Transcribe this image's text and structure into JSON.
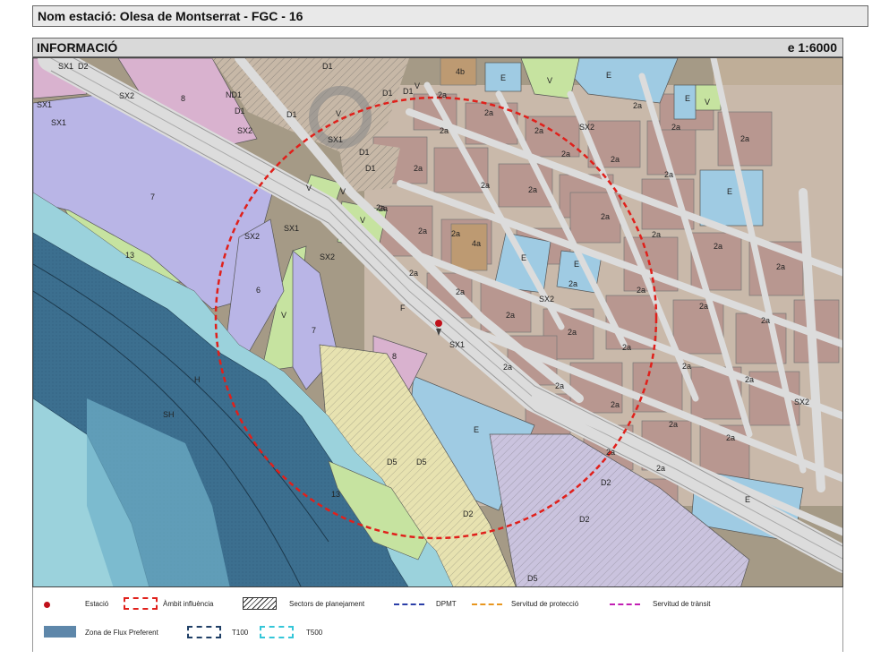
{
  "header": {
    "title": "Nom estació: Olesa de Montserrat - FGC - 16"
  },
  "panel": {
    "label": "INFORMACIÓ",
    "scale": "e 1:6000"
  },
  "map": {
    "labels": {
      "sx1": "SX1",
      "sx2": "SX2",
      "d1": "D1",
      "d2": "D2",
      "d5": "D5",
      "nd1": "ND1",
      "e": "E",
      "v": "V",
      "a2": "2a",
      "a4": "4a",
      "b4": "4b",
      "f": "F",
      "h": "H",
      "sh": "SH",
      "n6": "6",
      "n7": "7",
      "n8": "8",
      "n13": "13"
    }
  },
  "legend": {
    "station": "Estació",
    "influence": "Àmbit influència",
    "sectors": "Sectors de planejament",
    "dpmt": "DPMT",
    "protection": "Servitud de protecció",
    "transit": "Servitud de trànsit",
    "flux": "Zona de Flux Preferent",
    "t100": "T100",
    "t500": "T500"
  },
  "colors": {
    "urban": "#b89790",
    "equipment": "#9fcbe3",
    "green": "#c6e3a0",
    "river_zone": "#3c6f8f",
    "purple": "#b9b5e6",
    "pink": "#d9b2cf",
    "yellow": "#e7e2b0",
    "road": "#d8d8d8",
    "influence": "#e0201b",
    "station": "#c0101a"
  }
}
